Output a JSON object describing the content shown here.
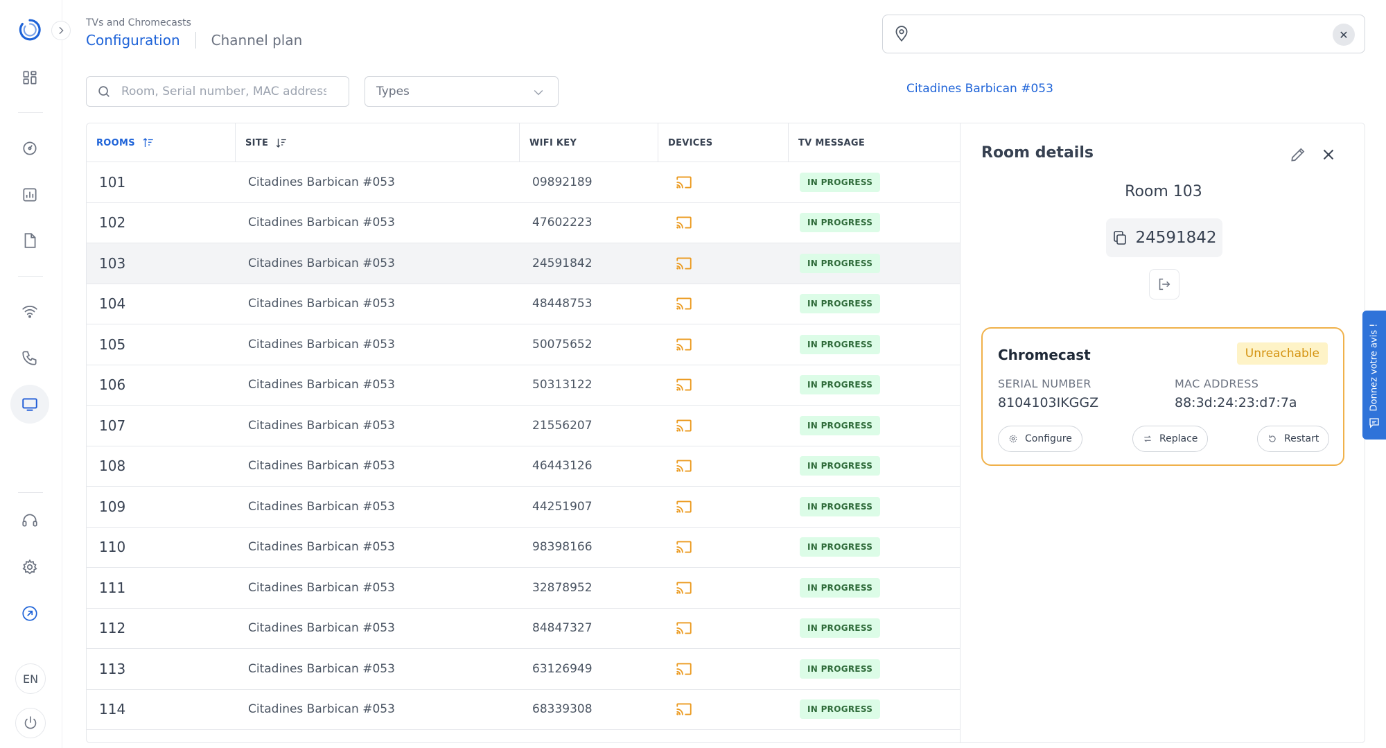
{
  "header": {
    "breadcrumb": "TVs and Chromecasts",
    "tabs": [
      {
        "label": "Configuration",
        "active": true
      },
      {
        "label": "Channel plan",
        "active": false
      }
    ]
  },
  "site_selector": {
    "value": "Citadines Barbican #053",
    "clear_icon": "close-icon"
  },
  "filters": {
    "search_placeholder": "Room, Serial number, MAC address",
    "types_placeholder": "Types"
  },
  "table": {
    "columns": [
      "ROOMS",
      "SITE",
      "WIFI KEY",
      "DEVICES",
      "TV MESSAGE"
    ],
    "rows": [
      {
        "room": "101",
        "site": "Citadines Barbican #053",
        "wifi": "09892189",
        "status": "IN PROGRESS"
      },
      {
        "room": "102",
        "site": "Citadines Barbican #053",
        "wifi": "47602223",
        "status": "IN PROGRESS"
      },
      {
        "room": "103",
        "site": "Citadines Barbican #053",
        "wifi": "24591842",
        "status": "IN PROGRESS"
      },
      {
        "room": "104",
        "site": "Citadines Barbican #053",
        "wifi": "48448753",
        "status": "IN PROGRESS"
      },
      {
        "room": "105",
        "site": "Citadines Barbican #053",
        "wifi": "50075652",
        "status": "IN PROGRESS"
      },
      {
        "room": "106",
        "site": "Citadines Barbican #053",
        "wifi": "50313122",
        "status": "IN PROGRESS"
      },
      {
        "room": "107",
        "site": "Citadines Barbican #053",
        "wifi": "21556207",
        "status": "IN PROGRESS"
      },
      {
        "room": "108",
        "site": "Citadines Barbican #053",
        "wifi": "46443126",
        "status": "IN PROGRESS"
      },
      {
        "room": "109",
        "site": "Citadines Barbican #053",
        "wifi": "44251907",
        "status": "IN PROGRESS"
      },
      {
        "room": "110",
        "site": "Citadines Barbican #053",
        "wifi": "98398166",
        "status": "IN PROGRESS"
      },
      {
        "room": "111",
        "site": "Citadines Barbican #053",
        "wifi": "32878952",
        "status": "IN PROGRESS"
      },
      {
        "room": "112",
        "site": "Citadines Barbican #053",
        "wifi": "84847327",
        "status": "IN PROGRESS"
      },
      {
        "room": "113",
        "site": "Citadines Barbican #053",
        "wifi": "63126949",
        "status": "IN PROGRESS"
      },
      {
        "room": "114",
        "site": "Citadines Barbican #053",
        "wifi": "68339308",
        "status": "IN PROGRESS"
      }
    ],
    "selected_room": "103"
  },
  "details": {
    "title": "Room details",
    "room_label": "Room 103",
    "wifi_key": "24591842",
    "device": {
      "name": "Chromecast",
      "status": "Unreachable",
      "serial_label": "SERIAL NUMBER",
      "serial_value": "8104103IKGGZ",
      "mac_label": "MAC ADDRESS",
      "mac_value": "88:3d:24:23:d7:7a",
      "actions": [
        "Configure",
        "Replace",
        "Restart"
      ]
    }
  },
  "sidebar": {
    "language": "EN"
  },
  "feedback": {
    "label": "Donnez votre avis !"
  },
  "colors": {
    "accent": "#1e63d8",
    "warning": "#f0b14a",
    "success_bg": "#dcfce7"
  }
}
